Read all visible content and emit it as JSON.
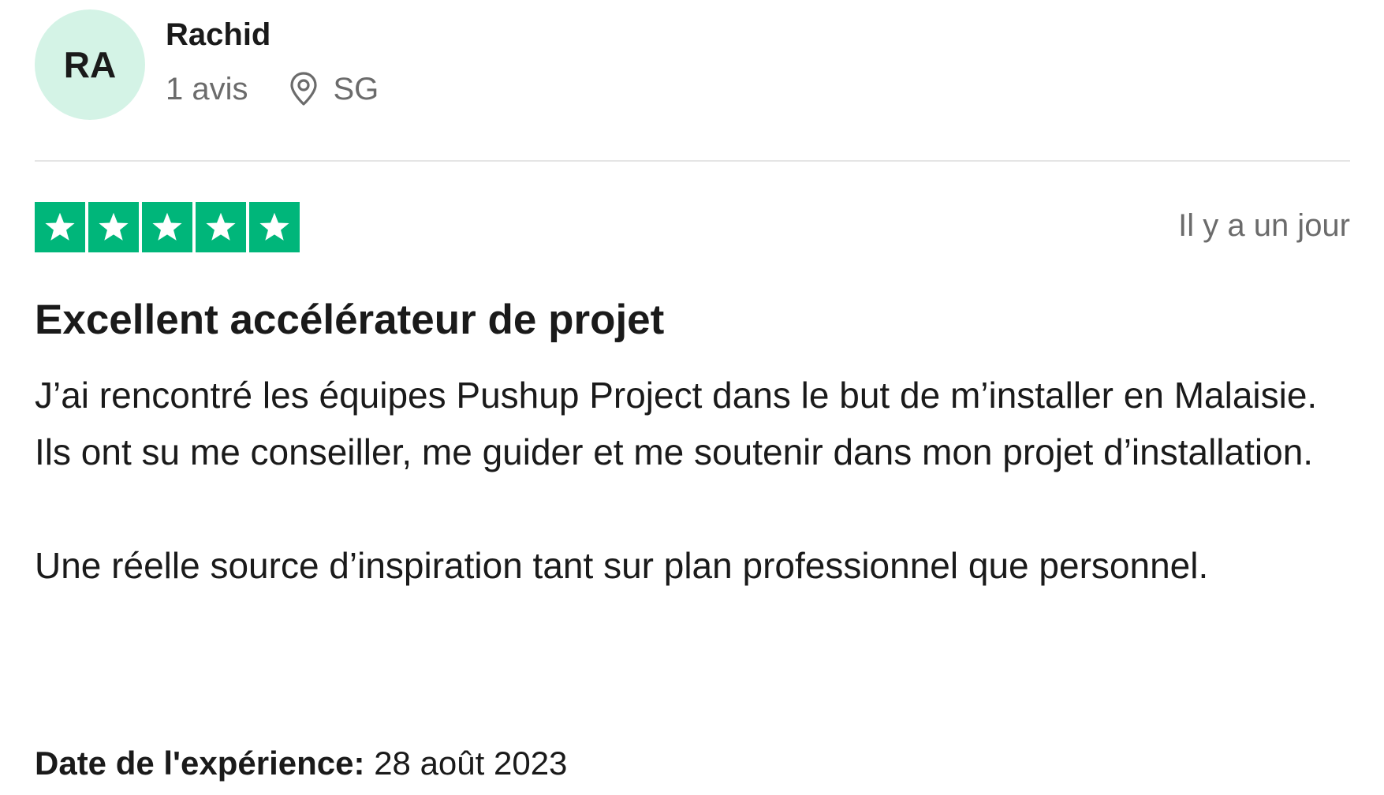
{
  "reviewer": {
    "initials": "RA",
    "name": "Rachid",
    "review_count": "1 avis",
    "location": "SG"
  },
  "review": {
    "rating": 5,
    "star_color": "#00b67a",
    "time_ago": "Il y a un jour",
    "title": "Excellent accélérateur de projet",
    "paragraphs": [
      "J’ai rencontré les équipes Pushup Project dans le but de m’installer en Malaisie. Ils ont su me conseiller, me guider et me soutenir dans mon projet d’installation.",
      "Une réelle source d’inspiration tant sur plan professionnel que personnel."
    ],
    "experience_label": "Date de l'expérience:",
    "experience_date": "28 août 2023"
  },
  "icons": {
    "location": "location-pin-icon",
    "star": "star-icon"
  },
  "colors": {
    "avatar_bg": "#d4f3e6",
    "muted_text": "#6b6b6b",
    "text": "#1a1a1a"
  }
}
